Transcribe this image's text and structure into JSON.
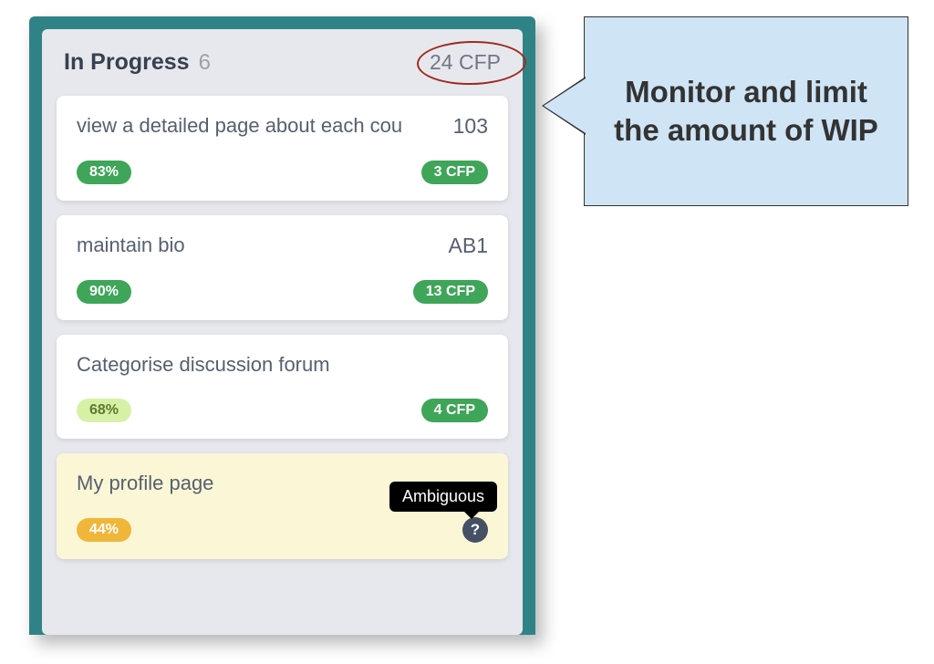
{
  "column": {
    "title": "In Progress",
    "count": "6",
    "total_cfp": "24 CFP"
  },
  "cards": [
    {
      "title": "view a detailed page about each cou",
      "id": "103",
      "pct": "83%",
      "pct_style": "pct-green",
      "cfp": "3 CFP",
      "variant": "normal"
    },
    {
      "title": "maintain bio",
      "id": "AB1",
      "pct": "90%",
      "pct_style": "pct-green",
      "cfp": "13 CFP",
      "variant": "normal"
    },
    {
      "title": "Categorise discussion forum",
      "id": "",
      "pct": "68%",
      "pct_style": "pct-lime",
      "cfp": "4 CFP",
      "variant": "normal"
    },
    {
      "title": "My profile page",
      "id": "",
      "pct": "44%",
      "pct_style": "pct-amber",
      "cfp": "",
      "variant": "warn",
      "tooltip": "Ambiguous",
      "help": "?"
    }
  ],
  "callout": {
    "text": "Monitor and limit the amount of WIP"
  }
}
